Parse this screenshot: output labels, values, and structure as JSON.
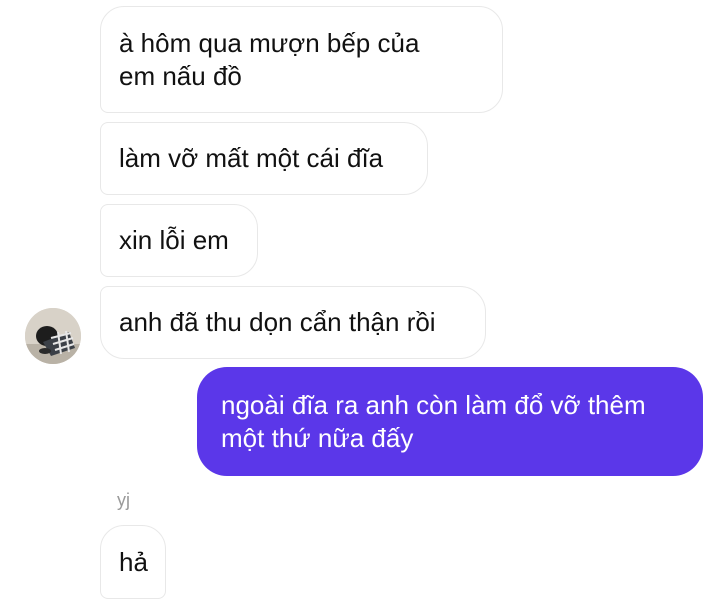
{
  "chat": {
    "messages": [
      {
        "id": "m1",
        "direction": "incoming",
        "text": "à hôm qua mượn bếp của\nem nấu đồ"
      },
      {
        "id": "m2",
        "direction": "incoming",
        "text": "làm vỡ mất một cái đĩa"
      },
      {
        "id": "m3",
        "direction": "incoming",
        "text": "xin lỗi em"
      },
      {
        "id": "m4",
        "direction": "incoming",
        "text": "anh đã thu dọn cẩn thận rồi"
      },
      {
        "id": "m5",
        "direction": "outgoing",
        "text": "ngoài đĩa ra anh còn làm đổ vỡ thêm\nmột thứ nữa đấy"
      },
      {
        "id": "m6",
        "direction": "incoming",
        "text": "hả"
      }
    ],
    "sender_name": "yj",
    "avatar_icon": "person-photo-icon"
  },
  "colors": {
    "outgoing_bubble": "#5b37e9",
    "incoming_bubble": "#ffffff",
    "incoming_border": "#e8e8e8",
    "sender_name": "#9a9a9a"
  }
}
